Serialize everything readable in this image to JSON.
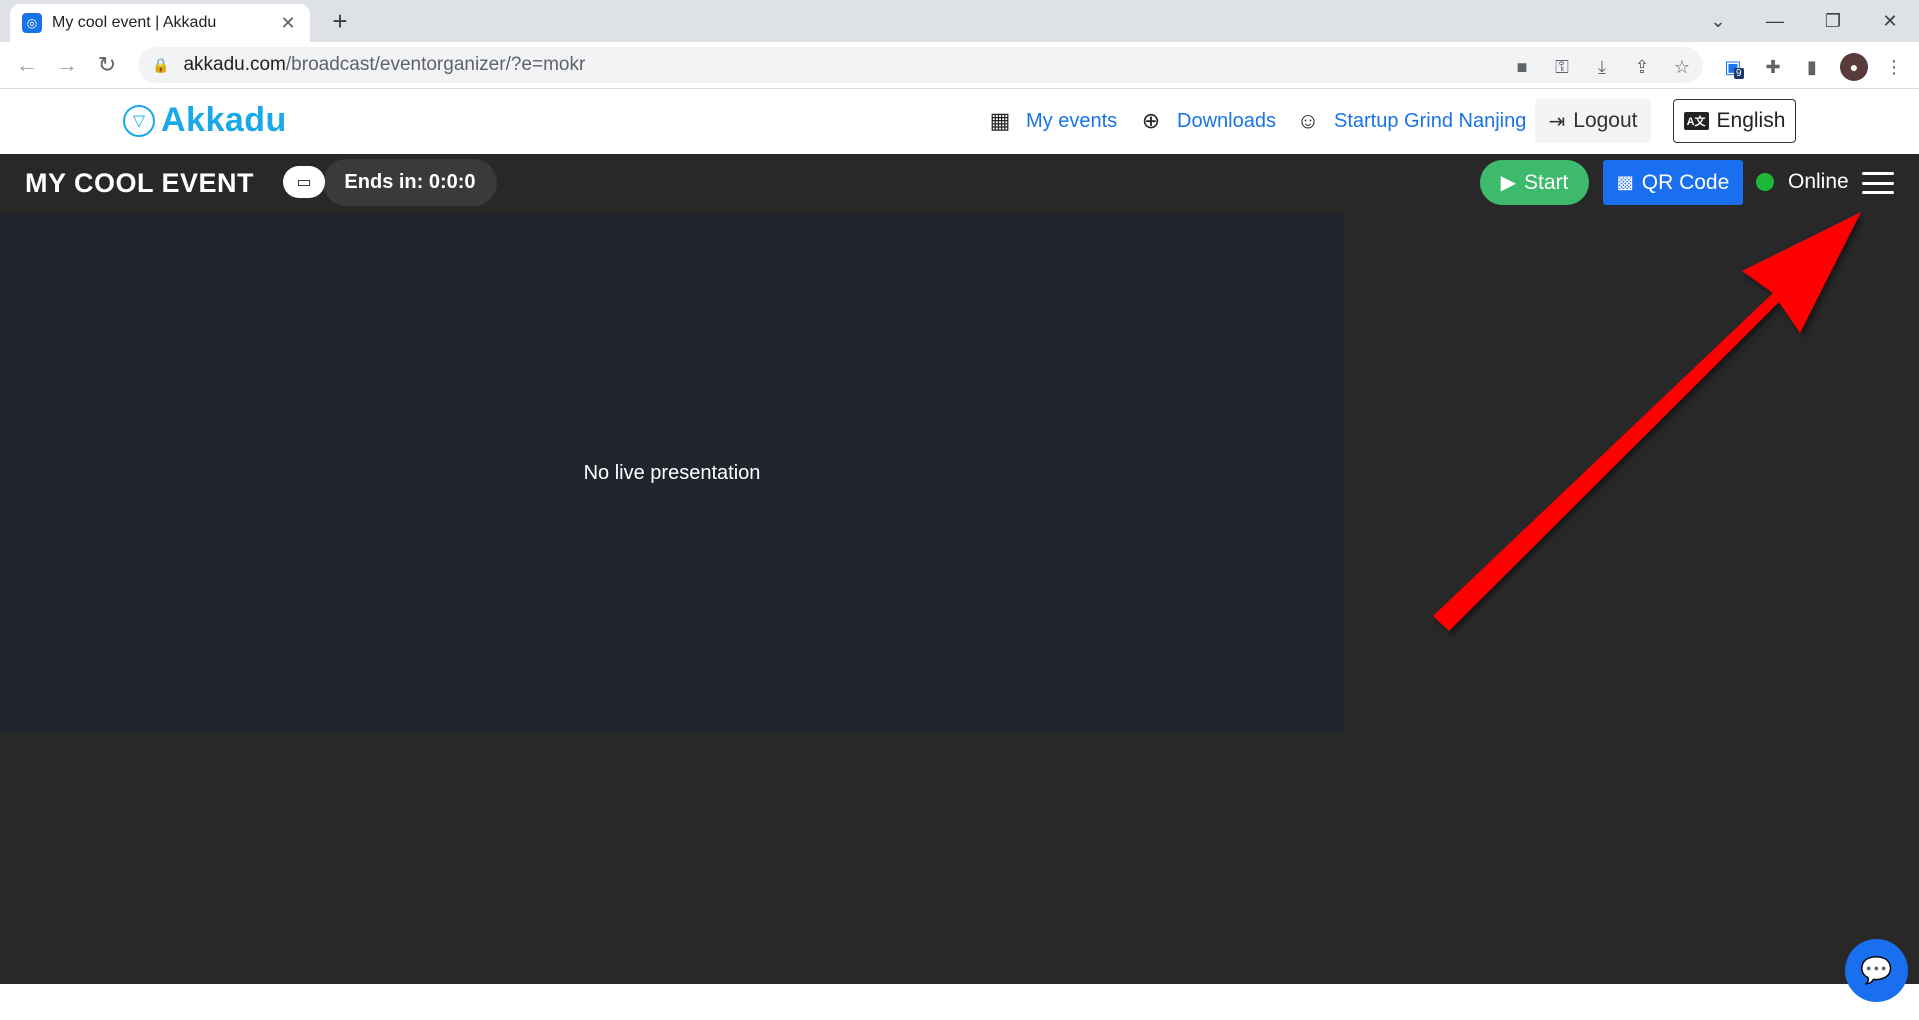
{
  "browser": {
    "tab_title": "My cool event | Akkadu",
    "new_tab": "+",
    "url_host": "akkadu.com",
    "url_path": "/broadcast/eventorganizer/?e=mokr",
    "extension_badge": "9"
  },
  "site": {
    "logo_text": "Akkadu",
    "nav": {
      "my_events": "My events",
      "downloads": "Downloads",
      "organization": "Startup Grind Nanjing",
      "logout": "Logout",
      "language": "English",
      "language_icon": "A文"
    }
  },
  "event": {
    "title": "MY COOL EVENT",
    "timer": "Ends in: 0:0:0",
    "start_label": "Start",
    "qr_label": "QR Code",
    "status": "Online"
  },
  "main": {
    "presentation_message": "No live presentation"
  },
  "colors": {
    "brand": "#1aa9e8",
    "start_green": "#3dba6c",
    "qr_blue": "#1a6ff0",
    "online_green": "#1db83a",
    "arrow_red": "#ff0000"
  }
}
